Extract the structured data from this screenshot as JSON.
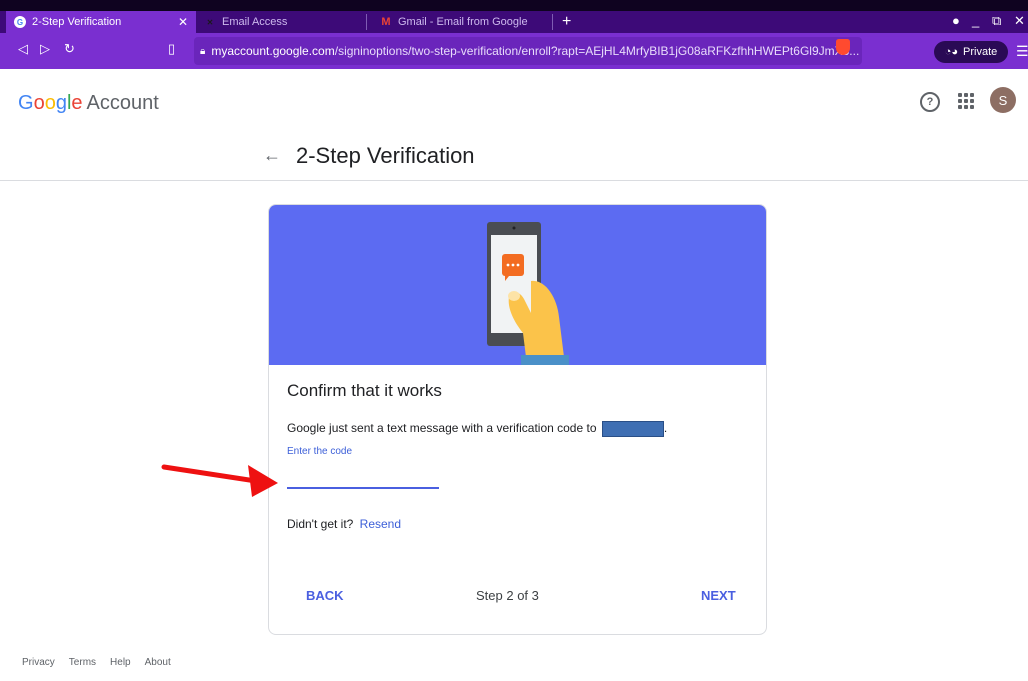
{
  "browser": {
    "tabs": [
      {
        "title": "2-Step Verification",
        "active": true
      },
      {
        "title": "Email Access",
        "active": false
      },
      {
        "title": "Gmail - Email from Google",
        "active": false
      }
    ],
    "new_tab_symbol": "+",
    "url_domain": "myaccount.google.com",
    "url_path": "/signinoptions/two-step-verification/enroll?rapt=AEjHL4MrfyBIB1jG08aRFKzfhhHWEPt6Gl9JmX8...",
    "private_label": "Private",
    "colors": {
      "tabbar": "#3d0a78",
      "toolbar": "#7a2fd0"
    }
  },
  "header": {
    "logo_text": "Google",
    "account_text": "Account",
    "avatar_letter": "S"
  },
  "page": {
    "title": "2-Step Verification"
  },
  "card": {
    "title": "Confirm that it works",
    "description": "Google just sent a text message with a verification code to",
    "code_label": "Enter the code",
    "code_value": "",
    "resend_prompt": "Didn't get it?",
    "resend_link": "Resend",
    "back_label": "BACK",
    "step_text": "Step 2 of 3",
    "next_label": "NEXT",
    "hero_color": "#5c6bf2"
  },
  "footer": {
    "links": [
      "Privacy",
      "Terms",
      "Help",
      "About"
    ]
  }
}
